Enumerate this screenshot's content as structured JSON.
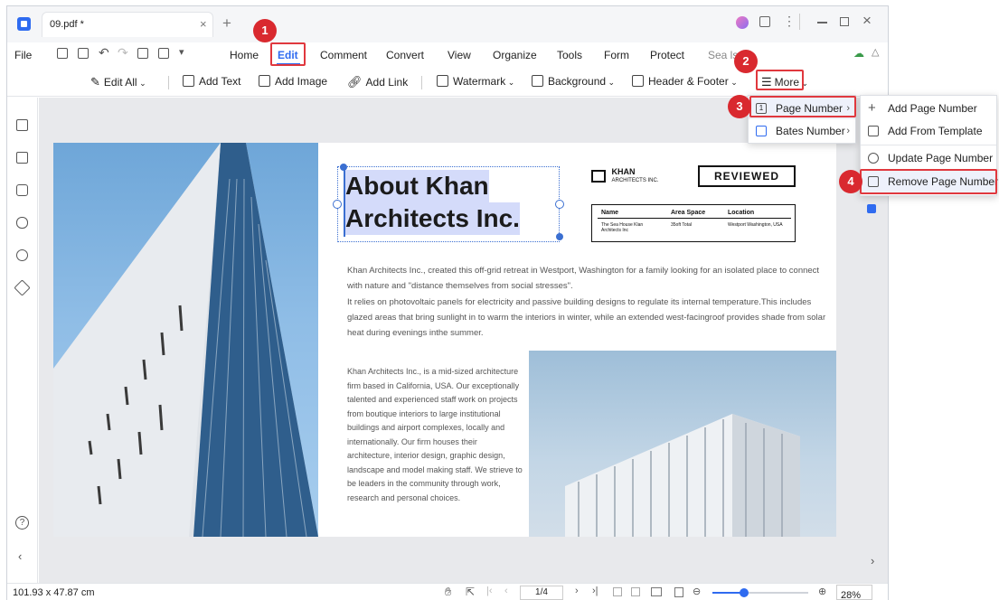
{
  "window": {
    "tab_title": "09.pdf *"
  },
  "menubar": {
    "file": "File",
    "items": [
      "Home",
      "Edit",
      "Comment",
      "Convert",
      "View",
      "Organize",
      "Tools",
      "Form",
      "Protect"
    ],
    "search": "Sea     ls"
  },
  "toolbar": {
    "edit_all": "Edit All",
    "add_text": "Add Text",
    "add_image": "Add Image",
    "add_link": "Add Link",
    "watermark": "Watermark",
    "background": "Background",
    "header_footer": "Header & Footer",
    "more": "More"
  },
  "more_menu": {
    "page_number": "Page Number",
    "bates_number": "Bates Number"
  },
  "page_number_menu": {
    "add": "Add Page Number",
    "add_template": "Add From Template",
    "update": "Update Page Number",
    "remove": "Remove Page Number"
  },
  "document": {
    "heading_line1": "About Khan",
    "heading_line2": "Architects Inc.",
    "logo_text_1": "KHAN",
    "logo_text_2": "ARCHITECTS INC.",
    "reviewed": "REVIEWED",
    "table": {
      "h1": "Name",
      "h2": "Area Space",
      "h3": "Location",
      "v1": "The Sea House Klan Architects Inc",
      "v2": "35oft Total",
      "v3": "Westport Washington, USA"
    },
    "para1": "Khan Architects Inc., created this off-grid retreat in Westport, Washington for a family looking for an isolated place to connect with nature and \"distance themselves from social stresses\".",
    "para2": "It relies on photovoltaic panels for electricity and passive building designs to regulate its internal temperature.This includes glazed areas that bring sunlight in to warm the interiors in winter, while an extended west-facingroof provides shade from solar heat during evenings inthe summer.",
    "para3": "Khan Architects Inc., is a mid-sized architecture firm based in California, USA. Our exceptionally talented and experienced staff work on projects from boutique interiors to large institutional buildings and airport complexes, locally and internationally. Our firm houses their architecture, interior design, graphic design, landscape and model making staff. We strieve to be leaders in the community through work, research and personal choices."
  },
  "status": {
    "dimensions": "101.93 x 47.87 cm",
    "page": "1/4",
    "zoom": "28%"
  },
  "badges": [
    "1",
    "2",
    "3",
    "4"
  ],
  "colors": {
    "accent": "#2f6bf0",
    "highlight_red": "#e0383e",
    "badge": "#d9292f"
  }
}
